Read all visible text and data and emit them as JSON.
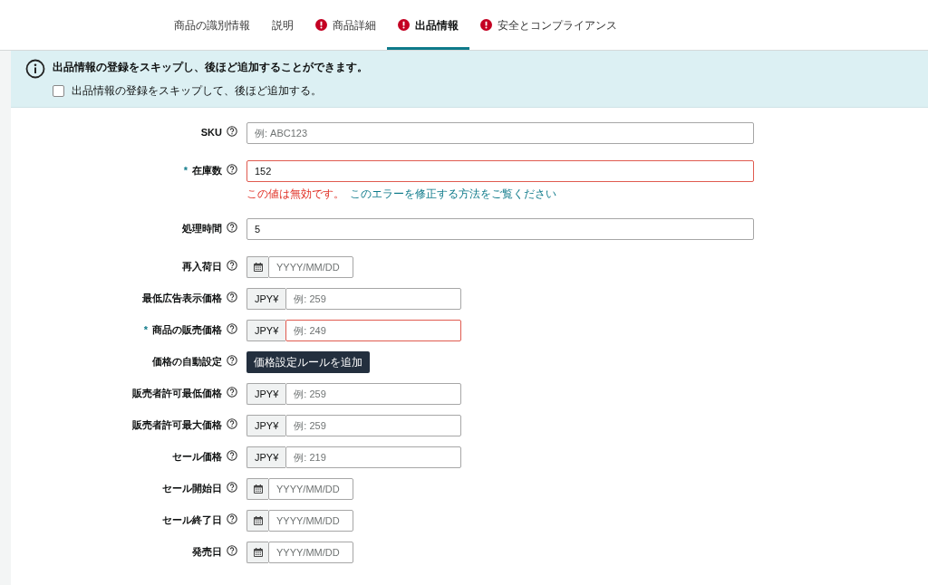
{
  "tabs": [
    {
      "label": "商品の識別情報",
      "alert": false,
      "selected": false
    },
    {
      "label": "説明",
      "alert": false,
      "selected": false
    },
    {
      "label": "商品詳細",
      "alert": true,
      "selected": false
    },
    {
      "label": "出品情報",
      "alert": true,
      "selected": true
    },
    {
      "label": "安全とコンプライアンス",
      "alert": true,
      "selected": false
    }
  ],
  "notice": {
    "message": "出品情報の登録をスキップし、後ほど追加することができます。",
    "checkbox": {
      "label": "出品情報の登録をスキップして、後ほど追加する。",
      "checked": false
    }
  },
  "fields": [
    {
      "label": "SKU",
      "kind": "text",
      "invalid": false,
      "placeholder": "例: ABC123"
    },
    {
      "label": "在庫数",
      "kind": "text",
      "required_mark": "*",
      "invalid": true,
      "value": "152",
      "error": {
        "message": "この値は無効です。",
        "link": "このエラーを修正する方法をご覧ください"
      }
    },
    {
      "label": "処理時間",
      "kind": "text",
      "invalid": false,
      "value": "5"
    },
    {
      "label": "再入荷日",
      "kind": "date",
      "invalid": false,
      "placeholder": "YYYY/MM/DD"
    },
    {
      "label": "最低広告表示価格",
      "kind": "price",
      "invalid": false,
      "prefix": "JPY¥",
      "placeholder": "例: 259"
    },
    {
      "label": "商品の販売価格",
      "kind": "price",
      "required_mark": "*",
      "invalid": true,
      "prefix": "JPY¥",
      "placeholder": "例: 249"
    },
    {
      "label": "価格の自動設定",
      "kind": "button",
      "button_label": "価格設定ルールを追加"
    },
    {
      "label": "販売者許可最低価格",
      "kind": "price",
      "invalid": false,
      "prefix": "JPY¥",
      "placeholder": "例: 259"
    },
    {
      "label": "販売者許可最大価格",
      "kind": "price",
      "invalid": false,
      "prefix": "JPY¥",
      "placeholder": "例: 259"
    },
    {
      "label": "セール価格",
      "kind": "price",
      "invalid": false,
      "prefix": "JPY¥",
      "placeholder": "例: 219"
    },
    {
      "label": "セール開始日",
      "kind": "date",
      "invalid": false,
      "placeholder": "YYYY/MM/DD"
    },
    {
      "label": "セール終了日",
      "kind": "date",
      "invalid": false,
      "placeholder": "YYYY/MM/DD"
    },
    {
      "label": "発売日",
      "kind": "date",
      "invalid": false,
      "placeholder": "YYYY/MM/DD"
    }
  ]
}
